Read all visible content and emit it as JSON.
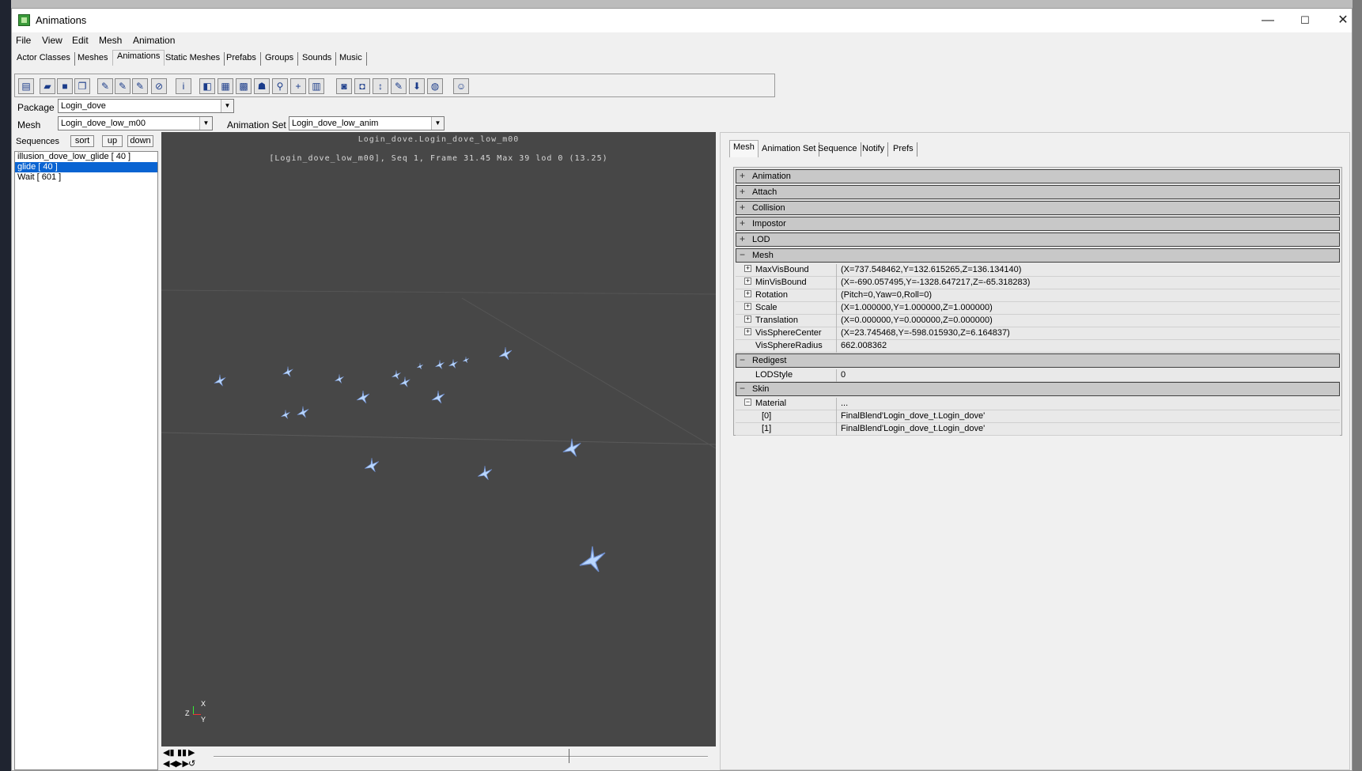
{
  "window": {
    "title": "Animations",
    "controls": {
      "minimize": "—",
      "maximize": "☐",
      "close": "✕"
    }
  },
  "menu": [
    "File",
    "View",
    "Edit",
    "Mesh",
    "Animation"
  ],
  "main_tabs": [
    "Actor Classes",
    "Meshes",
    "Animations",
    "Static Meshes",
    "Prefabs",
    "Groups",
    "Sounds",
    "Music"
  ],
  "toolbar_icons": [
    "new-package-icon",
    "open-icon",
    "save-icon",
    "copy-icon",
    "import-mesh-icon",
    "import-anim-icon",
    "export-icon",
    "link-icon",
    "info-icon",
    "cube-icon",
    "wireframe-icon",
    "grid-icon",
    "skeleton-icon",
    "bone-icon",
    "pivot-icon",
    "material-icon",
    "refresh-icon",
    "sequence-icon",
    "notify-icon",
    "edit-icon",
    "download-icon",
    "lock-icon",
    "person-icon"
  ],
  "package": {
    "label": "Package",
    "value": "Login_dove"
  },
  "mesh": {
    "label": "Mesh",
    "value": "Login_dove_low_m00"
  },
  "animset": {
    "label": "Animation Set",
    "value": "Login_dove_low_anim"
  },
  "sequences": {
    "label": "Sequences",
    "sort": "sort",
    "up": "up",
    "down": "down",
    "items": [
      "illusion_dove_low_glide [ 40 ]",
      "glide [ 40 ]",
      "Wait [ 601 ]"
    ],
    "selected_index": 1
  },
  "viewport": {
    "line1": "Login_dove.Login_dove_low_m00",
    "line2": "[Login_dove_low_m00], Seq 1,  Frame 31.45 Max 39  lod 0 (13.25)",
    "axis_x": "X",
    "axis_z": "Z",
    "axis_y": "Y"
  },
  "right_tabs": [
    "Mesh",
    "Animation Set",
    "Sequence",
    "Notify",
    "Prefs"
  ],
  "properties": {
    "categories": {
      "animation": "Animation",
      "attach": "Attach",
      "collision": "Collision",
      "impostor": "Impostor",
      "lod": "LOD",
      "mesh": "Mesh",
      "redigest": "Redigest",
      "skin": "Skin"
    },
    "mesh_props": [
      {
        "name": "MaxVisBound",
        "value": "(X=737.548462,Y=132.615265,Z=136.134140)"
      },
      {
        "name": "MinVisBound",
        "value": "(X=-690.057495,Y=-1328.647217,Z=-65.318283)"
      },
      {
        "name": "Rotation",
        "value": "(Pitch=0,Yaw=0,Roll=0)"
      },
      {
        "name": "Scale",
        "value": "(X=1.000000,Y=1.000000,Z=1.000000)"
      },
      {
        "name": "Translation",
        "value": "(X=0.000000,Y=0.000000,Z=0.000000)"
      },
      {
        "name": "VisSphereCenter",
        "value": "(X=23.745468,Y=-598.015930,Z=6.164837)"
      },
      {
        "name": "VisSphereRadius",
        "value": "662.008362"
      }
    ],
    "redigest_props": [
      {
        "name": "LODStyle",
        "value": "0"
      }
    ],
    "skin_props": {
      "material": {
        "name": "Material",
        "value": "..."
      },
      "items": [
        {
          "name": "[0]",
          "value": "FinalBlend'Login_dove_t.Login_dove'"
        },
        {
          "name": "[1]",
          "value": "FinalBlend'Login_dove_t.Login_dove'"
        }
      ]
    }
  },
  "colors": {
    "viewport_bg": "#474747",
    "selection": "#0a64d2",
    "bird": "#b9d7ff",
    "category_bg": "#c8c8c8"
  }
}
